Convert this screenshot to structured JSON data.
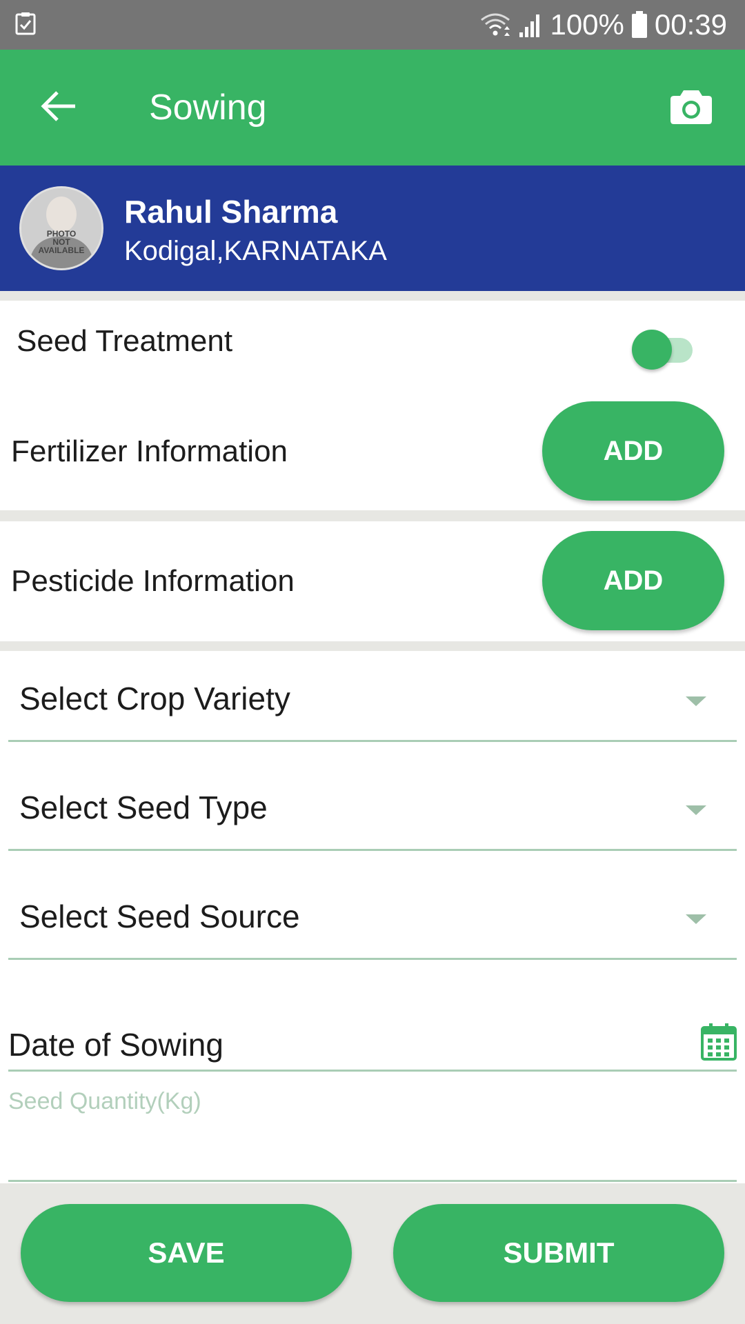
{
  "status_bar": {
    "battery": "100%",
    "time": "00:39"
  },
  "app_bar": {
    "title": "Sowing"
  },
  "profile": {
    "name": "Rahul Sharma",
    "location": "Kodigal,KARNATAKA",
    "avatar_text": [
      "PHOTO",
      "NOT",
      "AVAILABLE"
    ]
  },
  "form": {
    "seed_treatment_label": "Seed Treatment",
    "seed_treatment_on": true,
    "fertilizer_label": "Fertilizer Information",
    "fertilizer_button": "ADD",
    "pesticide_label": "Pesticide Information",
    "pesticide_button": "ADD",
    "crop_variety": "Select Crop Variety",
    "seed_type": "Select Seed Type",
    "seed_source": "Select Seed Source",
    "date_of_sowing": "Date of Sowing",
    "seed_quantity_placeholder": "Seed Quantity(Kg)"
  },
  "actions": {
    "save": "SAVE",
    "submit": "SUBMIT"
  },
  "colors": {
    "primary_green": "#38b464",
    "header_blue": "#233b97",
    "status_gray": "#757575"
  },
  "icons": {
    "status_left": "task-check-icon",
    "wifi": "wifi-icon",
    "signal": "signal-icon",
    "battery": "battery-icon",
    "back": "arrow-left-icon",
    "camera": "camera-icon",
    "dropdown": "caret-down-icon",
    "calendar": "calendar-icon"
  }
}
